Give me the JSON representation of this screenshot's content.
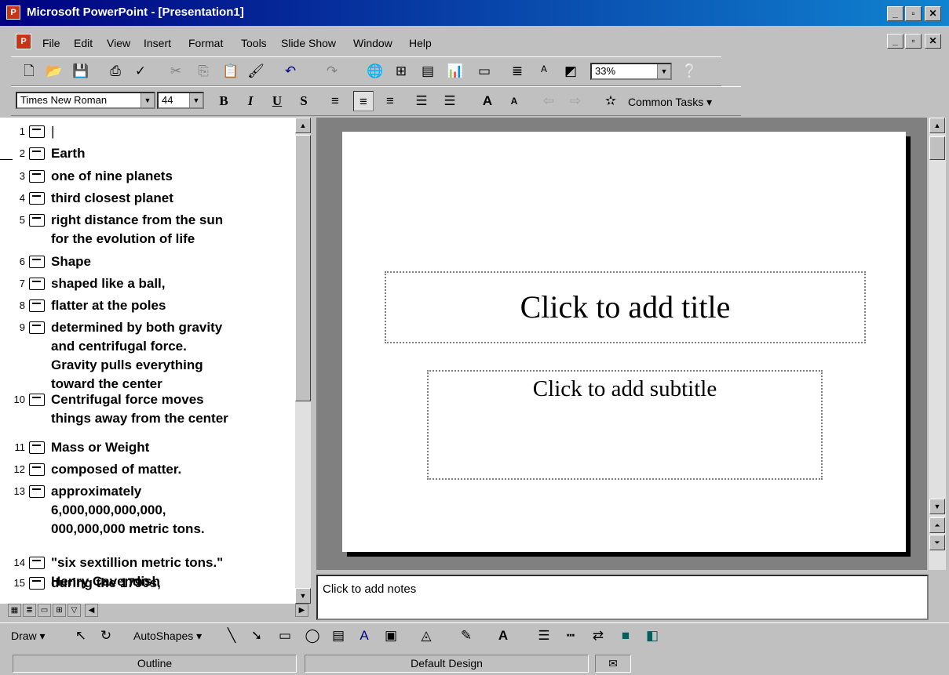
{
  "window": {
    "title": "Microsoft PowerPoint - [Presentation1]"
  },
  "menu": [
    "File",
    "Edit",
    "View",
    "Insert",
    "Format",
    "Tools",
    "Slide Show",
    "Window",
    "Help"
  ],
  "standard_toolbar": {
    "zoom": "33%"
  },
  "formatting_toolbar": {
    "font": "Times New Roman",
    "size": "44",
    "bold": "B",
    "italic": "I",
    "underline": "U",
    "shadow": "S",
    "common_tasks": "Common Tasks"
  },
  "outline": [
    {
      "num": "1",
      "text": "|"
    },
    {
      "num": "2",
      "text": "Earth"
    },
    {
      "num": "3",
      "text": "one of nine planets"
    },
    {
      "num": "4",
      "text": "third closest planet"
    },
    {
      "num": "5",
      "text": "right distance from the sun\nfor the evolution of life"
    },
    {
      "num": "6",
      "text": "Shape"
    },
    {
      "num": "7",
      "text": "shaped like a ball,"
    },
    {
      "num": "8",
      "text": "flatter at the poles"
    },
    {
      "num": "9",
      "text": "determined by both gravity\nand centrifugal force.\nGravity pulls everything\ntoward the center"
    },
    {
      "num": "10",
      "text": "Centrifugal force moves\nthings away from the center"
    },
    {
      "num": "11",
      "text": "Mass or Weight"
    },
    {
      "num": "12",
      "text": "composed of matter."
    },
    {
      "num": "13",
      "text": "approximately\n6,000,000,000,000,\n000,000,000 metric tons."
    },
    {
      "num": "14",
      "text": "\"six sextillion metric tons.\"\nHenry Cavendish"
    },
    {
      "num": "15",
      "text": "during the 1790s,"
    }
  ],
  "slide": {
    "title_placeholder": "Click to add title",
    "subtitle_placeholder": "Click to add subtitle"
  },
  "notes": {
    "placeholder": "Click to add notes"
  },
  "drawing_toolbar": {
    "draw": "Draw",
    "autoshapes": "AutoShapes"
  },
  "status": {
    "view": "Outline",
    "design": "Default Design"
  }
}
